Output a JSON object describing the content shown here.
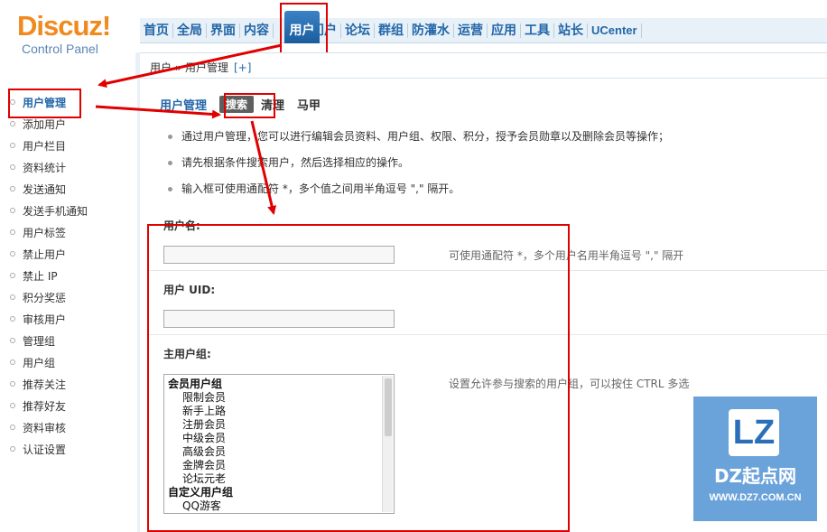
{
  "logo": {
    "main": "Discuz!",
    "sub": "Control Panel"
  },
  "nav": {
    "items": [
      "首页",
      "全局",
      "界面",
      "内容"
    ],
    "active": "用户",
    "items_after": [
      "门户",
      "论坛",
      "群组",
      "防灌水",
      "运营",
      "应用",
      "工具",
      "站长",
      "UCenter"
    ]
  },
  "breadcrumb": {
    "path": "用户 » 用户管理",
    "add": "[+]"
  },
  "sidebar": {
    "items": [
      "用户管理",
      "添加用户",
      "用户栏目",
      "资料统计",
      "发送通知",
      "发送手机通知",
      "用户标签",
      "禁止用户",
      "禁止 IP",
      "积分奖惩",
      "审核用户",
      "管理组",
      "用户组",
      "推荐关注",
      "推荐好友",
      "资料审核",
      "认证设置"
    ]
  },
  "tabs": {
    "title": "用户管理",
    "search": "搜索",
    "clean": "清理",
    "majia": "马甲"
  },
  "tips": [
    "通过用户管理，您可以进行编辑会员资料、用户组、权限、积分，授予会员勋章以及删除会员等操作；",
    "请先根据条件搜索用户，然后选择相应的操作。",
    "输入框可使用通配符 *，多个值之间用半角逗号 \",\" 隔开。"
  ],
  "form": {
    "username_label": "用户名:",
    "username_hint": "可使用通配符 *，多个用户名用半角逗号 \",\" 隔开",
    "uid_label": "用户 UID:",
    "group_label": "主用户组:",
    "group_hint": "设置允许参与搜索的用户组，可以按住 CTRL 多选",
    "group_options": [
      {
        "text": "会员用户组",
        "group": true
      },
      {
        "text": "限制会员",
        "group": false
      },
      {
        "text": "新手上路",
        "group": false
      },
      {
        "text": "注册会员",
        "group": false
      },
      {
        "text": "中级会员",
        "group": false
      },
      {
        "text": "高级会员",
        "group": false
      },
      {
        "text": "金牌会员",
        "group": false
      },
      {
        "text": "论坛元老",
        "group": false
      },
      {
        "text": "自定义用户组",
        "group": true
      },
      {
        "text": "QQ游客",
        "group": false
      }
    ]
  },
  "watermark": {
    "badge": "LZ",
    "title": "DZ起点网",
    "url": "WWW.DZ7.COM.CN"
  },
  "colors": {
    "accent": "#2366a8",
    "highlight": "#e00000",
    "logo": "#f08a1e"
  }
}
